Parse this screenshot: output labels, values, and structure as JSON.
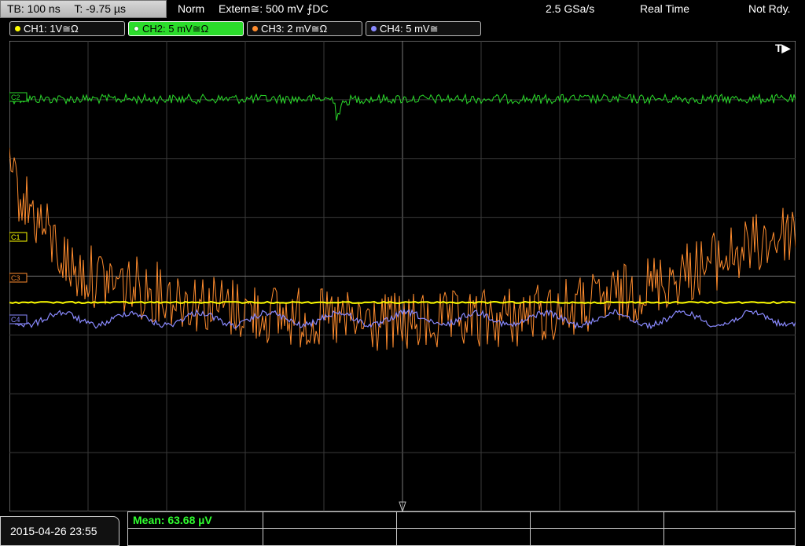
{
  "timebase": {
    "tb": "TB: 100 ns",
    "t": "T: -9.75 µs"
  },
  "trigger": {
    "mode": "Norm",
    "source": "Extern≅: 500 mV ⨍DC"
  },
  "acquisition": {
    "sample_rate": "2.5 GSa/s",
    "mode": "Real Time",
    "status": "Not Rdy."
  },
  "channels": [
    {
      "label": "CH1: 1V≅Ω",
      "color": "#ffff00"
    },
    {
      "label": "CH2: 5 mV≅Ω",
      "color": "#2bdc2b"
    },
    {
      "label": "CH3: 2 mV≅Ω",
      "color": "#ff8c2e"
    },
    {
      "label": "CH4: 5 mV≅",
      "color": "#8a8aff"
    }
  ],
  "markers": {
    "c1": "C1",
    "c3": "C3",
    "c4": "C4",
    "c2": "C2",
    "trigger_flag": "T▶"
  },
  "measurement": {
    "mean": "Mean: 63.68 µV"
  },
  "timestamp": "2015-04-26 23:55"
}
